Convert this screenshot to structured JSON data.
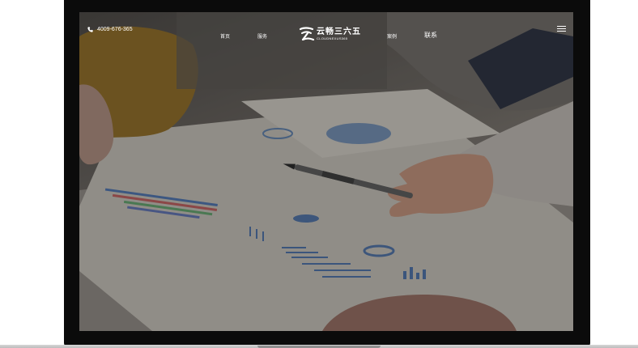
{
  "header": {
    "phone": "4009-676-365",
    "nav": {
      "home": "首页",
      "services": "服务",
      "cases": "案例",
      "contact": "联系"
    },
    "logo": {
      "name_cn": "云畅三六五",
      "name_en": "CLOUDNEXUS365"
    }
  },
  "icons": {
    "phone": "phone-icon",
    "logo": "logo-mark-icon",
    "menu": "hamburger-menu-icon"
  },
  "colors": {
    "bezel": "#0b0b0b",
    "header_text": "#ffffff"
  }
}
